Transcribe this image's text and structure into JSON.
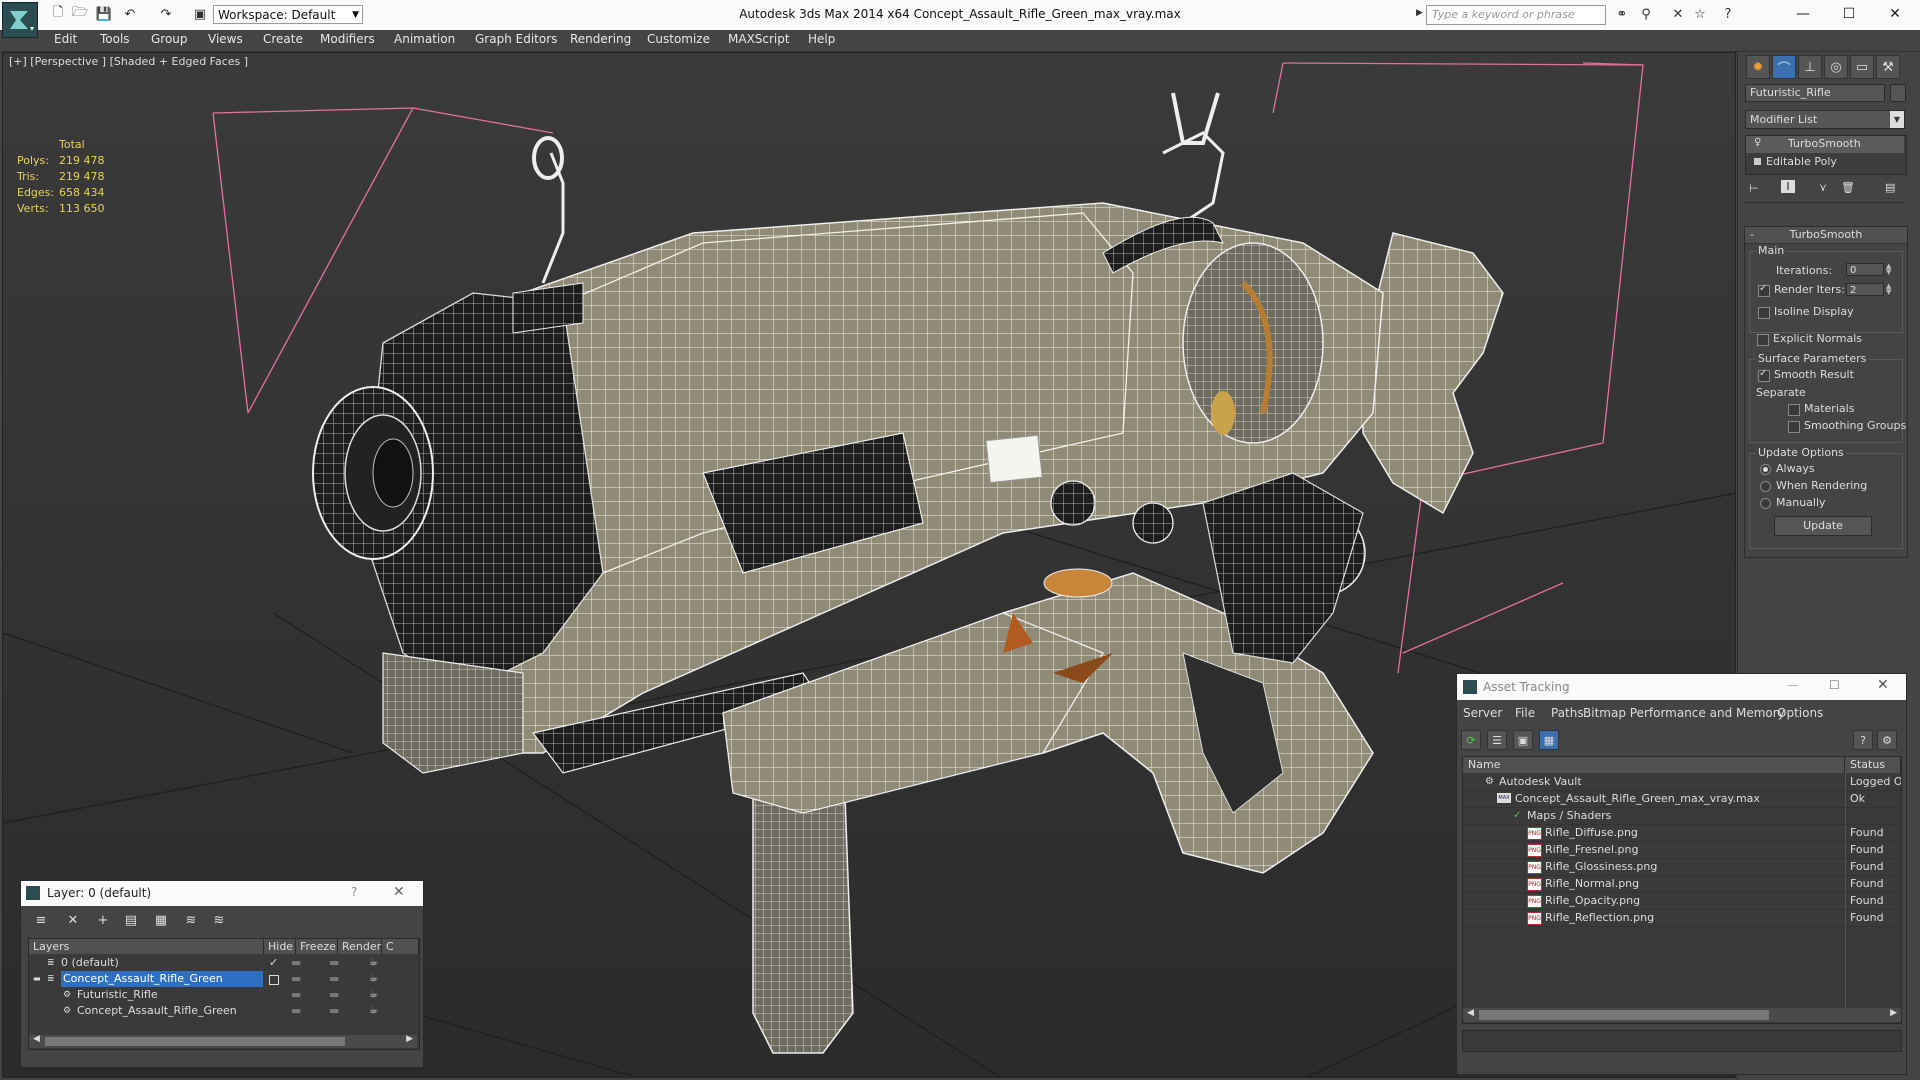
{
  "app": {
    "title": "Autodesk 3ds Max  2014 x64     Concept_Assault_Rifle_Green_max_vray.max",
    "workspace": "Workspace: Default",
    "search_placeholder": "Type a keyword or phrase"
  },
  "menu": [
    "Edit",
    "Tools",
    "Group",
    "Views",
    "Create",
    "Modifiers",
    "Animation",
    "Graph Editors",
    "Rendering",
    "Customize",
    "MAXScript",
    "Help"
  ],
  "viewport": {
    "label": "[+] [Perspective ] [Shaded + Edged Faces ]",
    "stats": {
      "header": "Total",
      "rows": [
        {
          "label": "Polys:",
          "value": "219 478"
        },
        {
          "label": "Tris:",
          "value": "219 478"
        },
        {
          "label": "Edges:",
          "value": "658 434"
        },
        {
          "label": "Verts:",
          "value": "113 650"
        }
      ]
    }
  },
  "command_panel": {
    "object_name": "Futuristic_Rifle",
    "modifier_list": "Modifier List",
    "stack": [
      "TurboSmooth",
      "Editable Poly"
    ],
    "rollout_title": "TurboSmooth",
    "main_label": "Main",
    "iterations_label": "Iterations:",
    "iterations_value": "0",
    "render_iters_label": "Render Iters:",
    "render_iters_value": "2",
    "render_iters_checked": true,
    "isoline_label": "Isoline Display",
    "explicit_normals_label": "Explicit Normals",
    "surface_params_label": "Surface Parameters",
    "smooth_result_label": "Smooth Result",
    "separate_label": "Separate",
    "materials_label": "Materials",
    "smoothing_groups_label": "Smoothing Groups",
    "update_options_label": "Update Options",
    "always_label": "Always",
    "when_rendering_label": "When Rendering",
    "manually_label": "Manually",
    "update_button": "Update"
  },
  "layer_window": {
    "title": "Layer: 0 (default)",
    "help": "?",
    "columns": [
      "Layers",
      "Hide",
      "Freeze",
      "Render",
      "C"
    ],
    "rows": [
      {
        "name": "0 (default)"
      },
      {
        "name": "Concept_Assault_Rifle_Green"
      },
      {
        "name": "Futuristic_Rifle"
      },
      {
        "name": "Concept_Assault_Rifle_Green"
      }
    ]
  },
  "asset_window": {
    "title": "Asset Tracking",
    "menu": [
      "Server",
      "File",
      "Paths",
      "Bitmap Performance and Memory",
      "Options"
    ],
    "columns": [
      "Name",
      "Status"
    ],
    "rows": [
      {
        "name": "Autodesk Vault",
        "status": "Logged Out"
      },
      {
        "name": "Concept_Assault_Rifle_Green_max_vray.max",
        "status": "Ok"
      },
      {
        "name": "Maps / Shaders",
        "status": ""
      },
      {
        "name": "Rifle_Diffuse.png",
        "status": "Found"
      },
      {
        "name": "Rifle_Fresnel.png",
        "status": "Found"
      },
      {
        "name": "Rifle_Glossiness.png",
        "status": "Found"
      },
      {
        "name": "Rifle_Normal.png",
        "status": "Found"
      },
      {
        "name": "Rifle_Opacity.png",
        "status": "Found"
      },
      {
        "name": "Rifle_Reflection.png",
        "status": "Found"
      }
    ],
    "png_label": "PNG",
    "max_label": "MAX"
  }
}
